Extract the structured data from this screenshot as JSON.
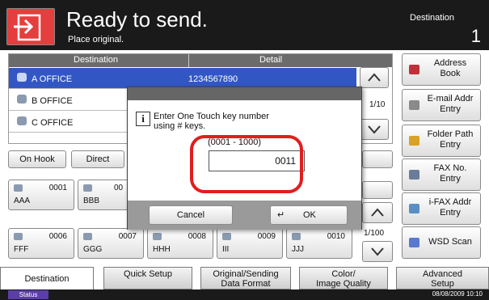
{
  "header": {
    "title": "Ready to send.",
    "subtitle": "Place original.",
    "destination_label": "Destination",
    "destination_count": "1"
  },
  "list": {
    "col_destination": "Destination",
    "col_detail": "Detail",
    "rows": [
      {
        "name": "A OFFICE",
        "detail": "1234567890"
      },
      {
        "name": "B OFFICE",
        "detail": ""
      },
      {
        "name": "C OFFICE",
        "detail": ""
      }
    ],
    "page": "1/10"
  },
  "buttons": {
    "on_hook": "On Hook",
    "direct": "Direct"
  },
  "keys_row1": [
    {
      "num": "0001",
      "label": "AAA"
    },
    {
      "num": "00",
      "label": "BBB"
    }
  ],
  "keys_row2": [
    {
      "num": "0006",
      "label": "FFF"
    },
    {
      "num": "0007",
      "label": "GGG"
    },
    {
      "num": "0008",
      "label": "HHH"
    },
    {
      "num": "0009",
      "label": "III"
    },
    {
      "num": "0010",
      "label": "JJJ"
    }
  ],
  "keys_page": "1/100",
  "right_buttons": [
    {
      "label": "Address Book",
      "icon": "address-book-icon",
      "color": "#c0303a"
    },
    {
      "label": "E-mail Addr Entry",
      "icon": "envelope-icon",
      "color": "#8a8a8a"
    },
    {
      "label": "Folder Path Entry",
      "icon": "folder-icon",
      "color": "#d7a227"
    },
    {
      "label": "FAX No. Entry",
      "icon": "fax-icon",
      "color": "#6a7c9a"
    },
    {
      "label": "i-FAX Addr Entry",
      "icon": "ifax-icon",
      "color": "#5a8fc4"
    },
    {
      "label": "WSD Scan",
      "icon": "wsd-scan-icon",
      "color": "#5a7ad0"
    }
  ],
  "dialog": {
    "message_line1": "Enter One Touch key number",
    "message_line2": "using # keys.",
    "range": "(0001 - 1000)",
    "value": "0011",
    "cancel": "Cancel",
    "ok": "OK"
  },
  "tabs": [
    {
      "line1": "Destination",
      "line2": ""
    },
    {
      "line1": "Quick Setup",
      "line2": ""
    },
    {
      "line1": "Original/Sending",
      "line2": "Data Format"
    },
    {
      "line1": "Color/",
      "line2": "Image Quality"
    },
    {
      "line1": "Advanced",
      "line2": "Setup"
    }
  ],
  "status": {
    "label": "Status",
    "datetime": "08/08/2009   10:10"
  },
  "colors": {
    "accent_red": "#e43e3e",
    "selection_blue": "#3257c5",
    "highlight_ring": "#e01e1e"
  }
}
